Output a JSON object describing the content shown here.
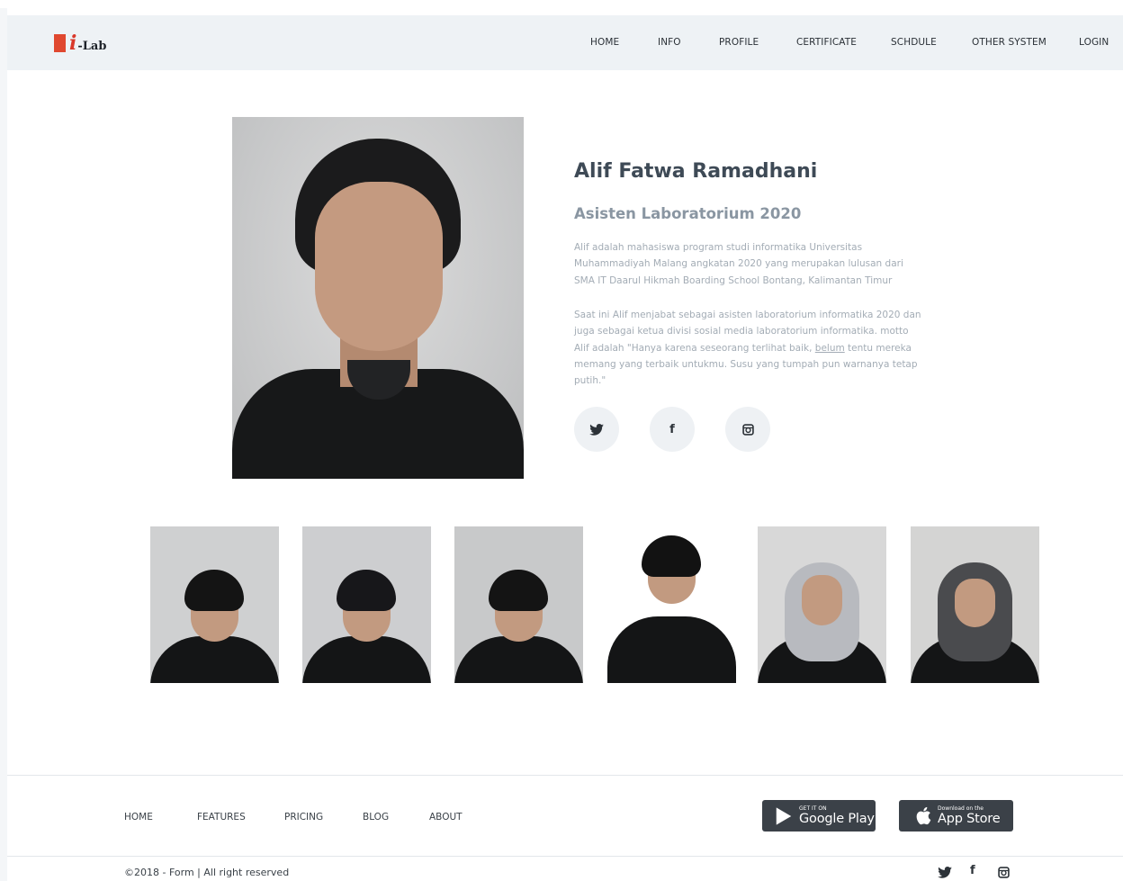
{
  "brand": {
    "logo_letter": "i",
    "logo_text": "-Lab",
    "logo_color": "#e0482f"
  },
  "nav": {
    "items": [
      {
        "label": "HOME"
      },
      {
        "label": "INFO"
      },
      {
        "label": "PROFILE"
      },
      {
        "label": "CERTIFICATE"
      },
      {
        "label": "SCHDULE"
      },
      {
        "label": "OTHER SYSTEM"
      },
      {
        "label": "LOGIN"
      }
    ]
  },
  "profile": {
    "name": "Alif Fatwa Ramadhani",
    "role": "Asisten Laboratorium 2020",
    "bio_1": "Alif adalah mahasiswa program studi informatika  Universitas Muhammadiyah Malang angkatan 2020 yang merupakan lulusan dari SMA IT Daarul Hikmah Boarding School Bontang, Kalimantan Timur",
    "bio_2_before": "Saat ini Alif menjabat sebagai asisten laboratorium informatika 2020 dan juga sebagai ketua divisi sosial media laboratorium informatika. motto Alif adalah \"Hanya karena seseorang terlihat baik, ",
    "bio_2_underlined": "belum",
    "bio_2_after": " tentu mereka memang yang terbaik untukmu. Susu yang tumpah pun warnanya tetap putih.\"",
    "social_icons": [
      "twitter-icon",
      "facebook-icon",
      "instagram-icon"
    ],
    "social_f_glyph": "f"
  },
  "team": {
    "members": [
      {
        "kind": "male",
        "bg": "#cfd0d1",
        "hair": "#141414"
      },
      {
        "kind": "male",
        "bg": "#cdced0",
        "hair": "#17171a"
      },
      {
        "kind": "male",
        "bg": "#c8c9ca",
        "hair": "#141414"
      },
      {
        "kind": "male",
        "bg": "#ffffff",
        "hair": "#121212"
      },
      {
        "kind": "female",
        "bg": "#d8d8d8",
        "hijab": "#b8babf"
      },
      {
        "kind": "female",
        "bg": "#d4d4d3",
        "hijab": "#4a4b4e"
      }
    ]
  },
  "footer": {
    "links": [
      {
        "label": "HOME"
      },
      {
        "label": "FEATURES"
      },
      {
        "label": "PRICING"
      },
      {
        "label": "BLOG"
      },
      {
        "label": "ABOUT"
      }
    ],
    "google_play": {
      "small": "GET IT ON",
      "big": "Google Play"
    },
    "app_store": {
      "small": "Download on the",
      "big": "App Store"
    },
    "copyright": "©2018 - Form  |  All right reserved",
    "social_icons": [
      "twitter-icon",
      "facebook-icon",
      "instagram-icon"
    ],
    "social_f_glyph": "f"
  }
}
